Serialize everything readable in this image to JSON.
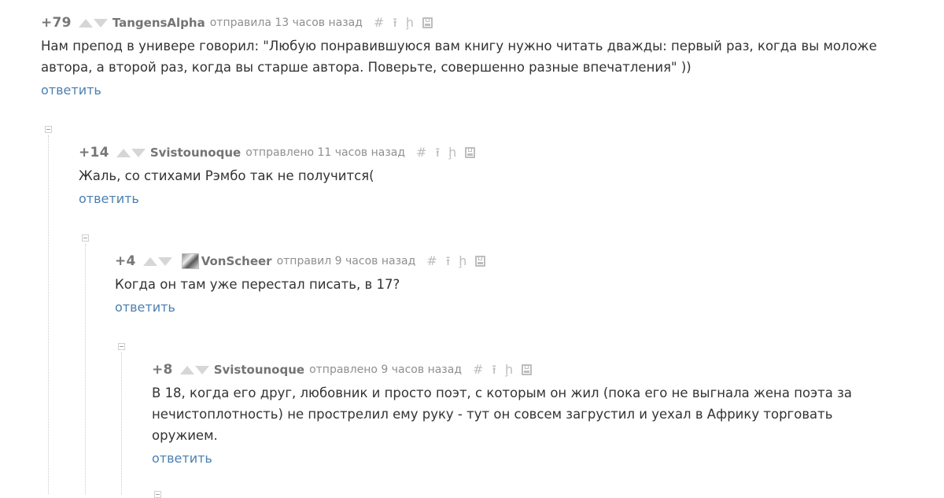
{
  "comments": [
    {
      "rating": "+79",
      "author": "TangensAlpha",
      "meta": "отправила 13 часов назад",
      "text": "Нам препод в универе говорил: \"Любую понравившуюся вам книгу нужно читать дважды: первый раз, когда вы моложе автора, а второй раз, когда вы старше автора. Поверьте, совершенно разные впечатления\" ))",
      "reply": "ответить",
      "has_avatar": false
    },
    {
      "rating": "+14",
      "author": "Svistounoque",
      "meta": "отправлено 11 часов назад",
      "text": "Жаль, со стихами Рэмбо так не получится(",
      "reply": "ответить",
      "has_avatar": false
    },
    {
      "rating": "+4",
      "author": "VonScheer",
      "meta": "отправил 9 часов назад",
      "text": "Когда он там уже перестал писать, в 17?",
      "reply": "ответить",
      "has_avatar": true
    },
    {
      "rating": "+8",
      "author": "Svistounoque",
      "meta": "отправлено 9 часов назад",
      "text": "В 18, когда его друг, любовник и просто поэт, с которым он жил (пока его не выгнала жена поэта за нечистоплотность) не прострелил ему руку - тут он совсем загрустил и уехал в Африку торговать оружием.",
      "reply": "ответить",
      "has_avatar": false
    }
  ],
  "icons": {
    "link": "hash-icon",
    "parent": "arrow-up-icon",
    "branch": "branch-icon",
    "save": "save-icon",
    "collapse": "collapse-icon"
  },
  "colors": {
    "rating": "#777777",
    "author": "#747474",
    "meta": "#8f8f8f",
    "reply_link": "#4a7fb0",
    "text": "#333333",
    "vote_arrow": "#d6d6d6"
  }
}
